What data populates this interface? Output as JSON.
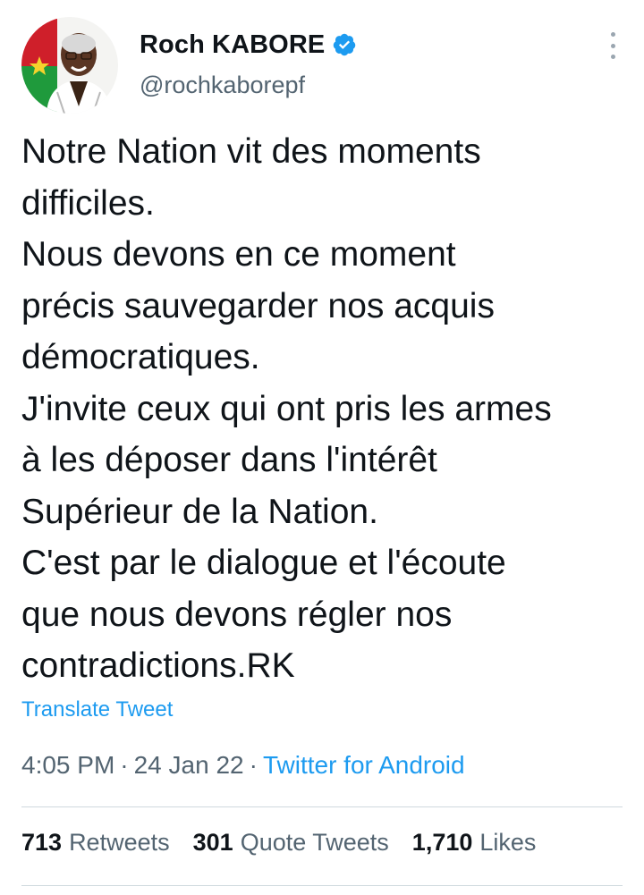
{
  "author": {
    "display_name": "Roch KABORE",
    "handle": "@rochkaborepf",
    "verified_icon": "verified-badge-icon",
    "verified_color": "#1d9bf0"
  },
  "tweet": {
    "lines": [
      "Notre Nation vit des moments",
      "difficiles.",
      "Nous devons en ce moment",
      "précis sauvegarder nos acquis",
      "démocratiques.",
      "J'invite ceux qui ont pris les armes",
      "à les déposer dans l'intérêt",
      "Supérieur de la Nation.",
      "C'est par le dialogue et l'écoute",
      "que nous devons régler nos",
      "contradictions.RK"
    ],
    "translate_label": "Translate Tweet"
  },
  "meta": {
    "time": "4:05 PM",
    "separator": "·",
    "date": "24 Jan 22",
    "source": "Twitter for Android"
  },
  "stats": {
    "retweets_count": "713",
    "retweets_label": "Retweets",
    "quotes_count": "301",
    "quotes_label": "Quote Tweets",
    "likes_count": "1,710",
    "likes_label": "Likes"
  },
  "colors": {
    "link": "#1d9bf0",
    "secondary_text": "#536471",
    "primary_text": "#0f1419",
    "divider": "#cfd9de"
  }
}
